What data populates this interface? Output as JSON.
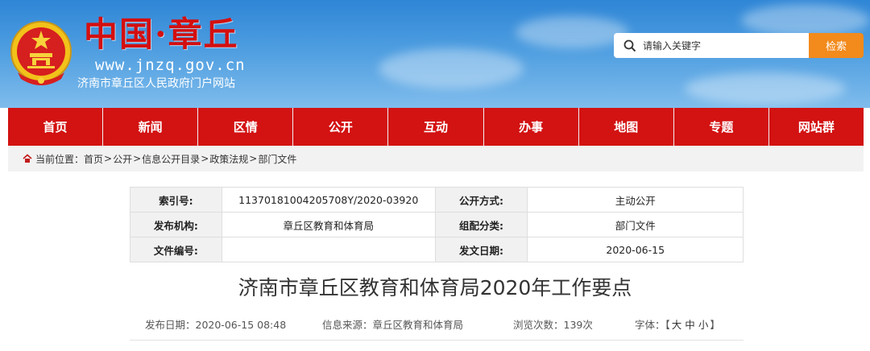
{
  "header": {
    "title": "中国·章丘",
    "url": "www.jnzq.gov.cn",
    "subtitle": "济南市章丘区人民政府门户网站",
    "emblem_icon": "national-emblem"
  },
  "search": {
    "placeholder": "请输入关键字",
    "button_label": "检索"
  },
  "nav": {
    "items": [
      {
        "label": "首页"
      },
      {
        "label": "新闻"
      },
      {
        "label": "区情"
      },
      {
        "label": "公开"
      },
      {
        "label": "互动"
      },
      {
        "label": "办事"
      },
      {
        "label": "地图"
      },
      {
        "label": "专题"
      },
      {
        "label": "网站群"
      }
    ]
  },
  "breadcrumb": {
    "prefix": "当前位置：",
    "items": [
      "首页",
      "公开",
      "信息公开目录",
      "政策法规",
      "部门文件"
    ],
    "separator": ">"
  },
  "meta": {
    "rows": [
      {
        "l1": "索引号:",
        "v1": "11370181004205708Y/2020-03920",
        "l2": "公开方式:",
        "v2": "主动公开"
      },
      {
        "l1": "发布机构:",
        "v1": "章丘区教育和体育局",
        "l2": "组配分类:",
        "v2": "部门文件"
      },
      {
        "l1": "文件编号:",
        "v1": "",
        "l2": "发文日期:",
        "v2": "2020-06-15"
      }
    ]
  },
  "article": {
    "title": "济南市章丘区教育和体育局2020年工作要点",
    "publish_date": "发布日期：2020-06-15 08:48",
    "source": "信息来源：章丘区教育和体育局",
    "views": "浏览次数：139次",
    "font_label": "字体：",
    "font_open": "【",
    "font_large": "大",
    "font_medium": "中",
    "font_small": "小",
    "font_close": "】"
  },
  "colors": {
    "nav_bg": "#d31212",
    "search_button": "#f28a1c",
    "title_red": "#d40f0f"
  }
}
